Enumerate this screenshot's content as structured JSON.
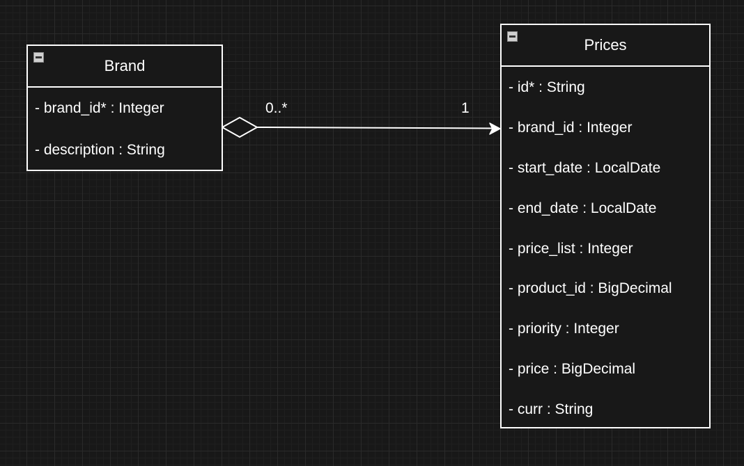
{
  "classes": {
    "brand": {
      "name": "Brand",
      "attributes": [
        "- brand_id* : Integer",
        "- description : String"
      ]
    },
    "prices": {
      "name": "Prices",
      "attributes": [
        "- id* : String",
        "- brand_id : Integer",
        "- start_date : LocalDate",
        "- end_date : LocalDate",
        "- price_list : Integer",
        "- product_id : BigDecimal",
        "- priority : Integer",
        "- price : BigDecimal",
        "- curr : String"
      ]
    }
  },
  "association": {
    "type": "aggregation",
    "source_multiplicity": "0..*",
    "target_multiplicity": "1"
  },
  "icons": {
    "collapse": "minus-square-icon",
    "aggregation": "hollow-diamond-icon",
    "arrow": "open-arrowhead-icon"
  },
  "colors": {
    "background": "#181818",
    "grid": "#2a2a2a",
    "stroke": "#ffffff",
    "text": "#ffffff"
  }
}
